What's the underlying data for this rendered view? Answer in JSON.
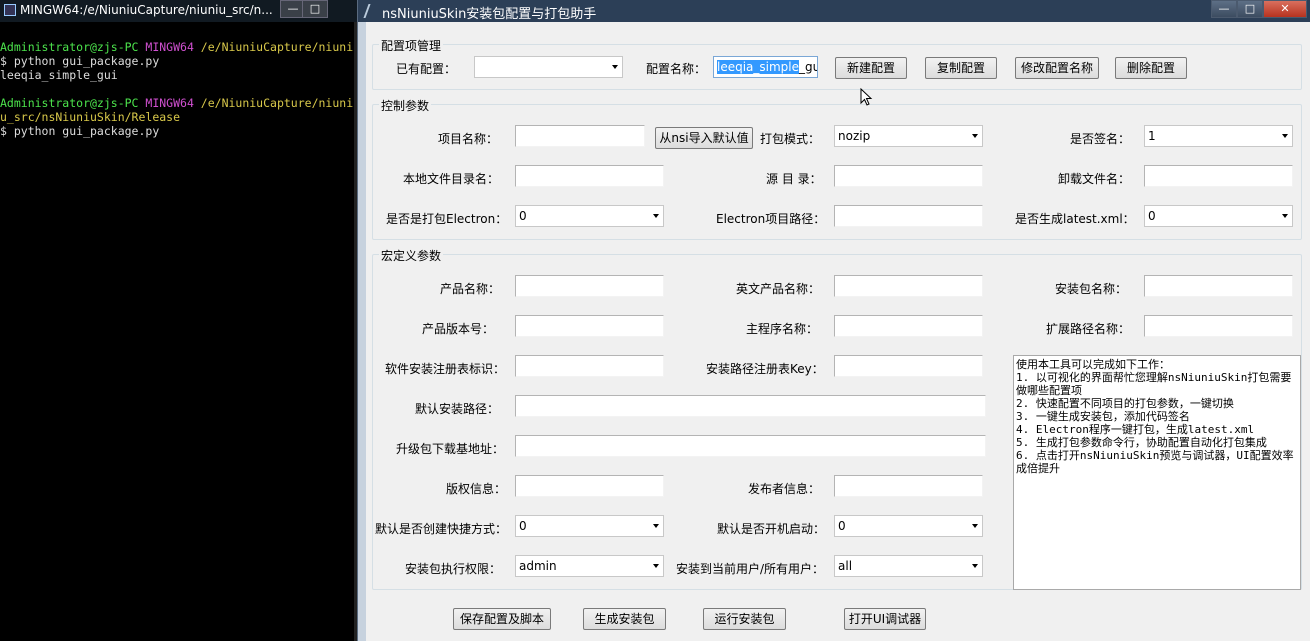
{
  "terminal": {
    "title": "MINGW64:/e/NiuniuCapture/niuniu_src/n...",
    "btn_min": "—",
    "btn_max": "□",
    "lines": [
      {
        "parts": [
          [
            "green",
            "Administrator@zjs-PC "
          ],
          [
            "magenta",
            "MINGW64 "
          ],
          [
            "yellow",
            "/e/NiuniuCapture/niuni"
          ]
        ]
      },
      {
        "parts": [
          [
            "plain",
            "$ python gui_package.py"
          ]
        ]
      },
      {
        "parts": [
          [
            "plain",
            "leeqia_simple_gui"
          ]
        ]
      },
      {
        "parts": [
          [
            "plain",
            ""
          ]
        ]
      },
      {
        "parts": [
          [
            "green",
            "Administrator@zjs-PC "
          ],
          [
            "magenta",
            "MINGW64 "
          ],
          [
            "yellow",
            "/e/NiuniuCapture/niuni"
          ]
        ]
      },
      {
        "parts": [
          [
            "yellow",
            "u_src/nsNiuniuSkin/Release"
          ]
        ]
      },
      {
        "parts": [
          [
            "plain",
            "$ python gui_package.py"
          ]
        ]
      }
    ]
  },
  "window": {
    "title": "nsNiuniuSkin安装包配置与打包助手",
    "btn_min": "—",
    "btn_max": "□",
    "btn_close": "✕"
  },
  "config": {
    "group_title": "配置项管理",
    "existing_label": "已有配置：",
    "existing_value": "",
    "name_label": "配置名称：",
    "name_value_selected": "leeqia_simple",
    "name_value_rest": "_gu",
    "new_btn": "新建配置",
    "copy_btn": "复制配置",
    "rename_btn": "修改配置名称",
    "delete_btn": "删除配置"
  },
  "control": {
    "group_title": "控制参数",
    "project_name_label": "项目名称：",
    "project_name_value": "",
    "import_btn": "从nsi导入默认值",
    "pack_mode_label": "打包模式：",
    "pack_mode_value": "nozip",
    "sign_label": "是否签名：",
    "sign_value": "1",
    "local_dir_label": "本地文件目录名：",
    "local_dir_value": "",
    "source_dir_label": "源 目 录：",
    "source_dir_value": "",
    "uninstall_label": "卸载文件名：",
    "uninstall_value": "",
    "electron_label": "是否是打包Electron：",
    "electron_value": "0",
    "electron_path_label": "Electron项目路径：",
    "electron_path_value": "",
    "latest_label": "是否生成latest.xml：",
    "latest_value": "0"
  },
  "macro": {
    "group_title": "宏定义参数",
    "product_name_label": "产品名称：",
    "en_product_label": "英文产品名称：",
    "pkg_name_label": "安装包名称：",
    "version_label": "产品版本号：",
    "main_prog_label": "主程序名称：",
    "ext_path_label": "扩展路径名称：",
    "reg_id_label": "软件安装注册表标识：",
    "reg_key_label": "安装路径注册表Key：",
    "default_path_label": "默认安装路径：",
    "upgrade_url_label": "升级包下载基地址：",
    "copyright_label": "版权信息：",
    "publisher_label": "发布者信息：",
    "shortcut_label": "默认是否创建快捷方式：",
    "shortcut_value": "0",
    "autostart_label": "默认是否开机启动：",
    "autostart_value": "0",
    "privilege_label": "安装包执行权限：",
    "privilege_value": "admin",
    "scope_label": "安装到当前用户/所有用户：",
    "scope_value": "all"
  },
  "info_text": "使用本工具可以完成如下工作：\n1. 以可视化的界面帮忙您理解nsNiuniuSkin打包需要做哪些配置项\n2. 快速配置不同项目的打包参数，一键切换\n3. 一键生成安装包，添加代码签名\n4. Electron程序一键打包，生成latest.xml\n5. 生成打包参数命令行，协助配置自动化打包集成\n6. 点击打开nsNiuniuSkin预览与调试器，UI配置效率成倍提升",
  "bottom": {
    "save_btn": "保存配置及脚本",
    "build_btn": "生成安装包",
    "run_btn": "运行安装包",
    "ui_btn": "打开UI调试器"
  }
}
